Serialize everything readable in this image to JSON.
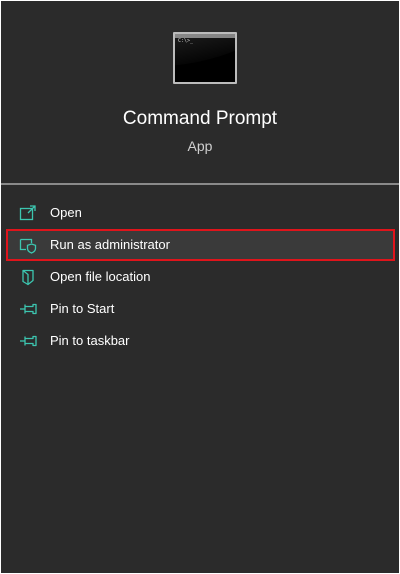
{
  "app": {
    "title": "Command Prompt",
    "kind": "App",
    "icon": "command-prompt-icon",
    "prompt_glyph": "C:\\>_"
  },
  "menu": {
    "items": [
      {
        "label": "Open",
        "icon": "open-icon"
      },
      {
        "label": "Run as administrator",
        "icon": "shield-icon",
        "highlighted": true
      },
      {
        "label": "Open file location",
        "icon": "folder-icon"
      },
      {
        "label": "Pin to Start",
        "icon": "pin-icon"
      },
      {
        "label": "Pin to taskbar",
        "icon": "pin-icon"
      }
    ]
  },
  "colors": {
    "panel_background": "#2b2b2b",
    "icon_accent": "#3cc6b0",
    "highlight_border": "#e0141b"
  }
}
